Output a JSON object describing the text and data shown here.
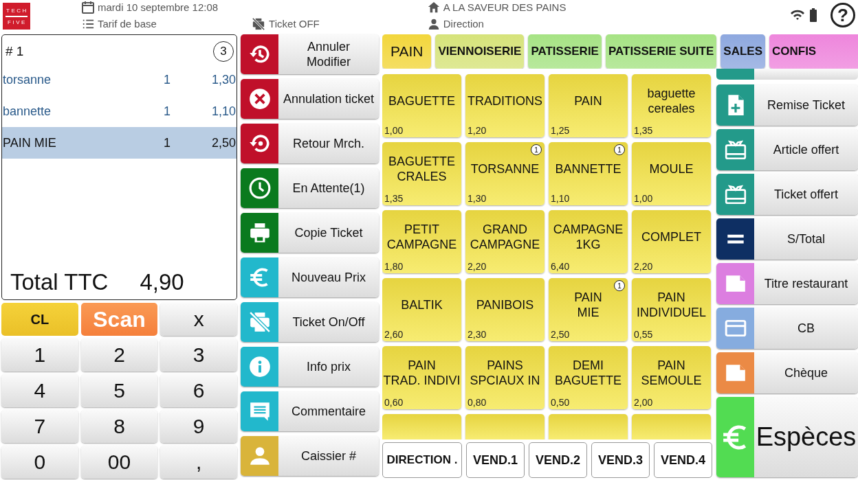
{
  "header": {
    "logo": {
      "top": "TECH",
      "bottom": "FIVE"
    },
    "date": "mardi 10 septembre 12:08",
    "tariff": "Tarif de base",
    "ticket_status": "Ticket OFF",
    "shop": "A LA SAVEUR DES PAINS",
    "user": "Direction",
    "help": "?"
  },
  "ticket": {
    "number": "# 1",
    "count": "3",
    "lines": [
      {
        "name": "torsanne",
        "qty": "1",
        "price": "1,30",
        "selected": false
      },
      {
        "name": "bannette",
        "qty": "1",
        "price": "1,10",
        "selected": false
      },
      {
        "name": "PAIN MIE",
        "qty": "1",
        "price": "2,50",
        "selected": true
      }
    ],
    "total_label": "Total TTC",
    "total": "4,90"
  },
  "keypad": [
    {
      "label": "CL",
      "kind": "clear"
    },
    {
      "label": "Scan",
      "kind": "scan"
    },
    {
      "label": "x",
      "kind": "key"
    },
    {
      "label": "1",
      "kind": "key"
    },
    {
      "label": "2",
      "kind": "key"
    },
    {
      "label": "3",
      "kind": "key"
    },
    {
      "label": "4",
      "kind": "key"
    },
    {
      "label": "5",
      "kind": "key"
    },
    {
      "label": "6",
      "kind": "key"
    },
    {
      "label": "7",
      "kind": "key"
    },
    {
      "label": "8",
      "kind": "key"
    },
    {
      "label": "9",
      "kind": "key"
    },
    {
      "label": "0",
      "kind": "key"
    },
    {
      "label": "00",
      "kind": "key"
    },
    {
      "label": ",",
      "kind": "key"
    }
  ],
  "actions": [
    {
      "label": "Annuler\nModifier",
      "kind": "history",
      "color": "#c0102a"
    },
    {
      "label": "Annulation ticket",
      "kind": "cancel",
      "color": "#c0102a"
    },
    {
      "label": "Retour Mrch.",
      "kind": "restore",
      "color": "#c0102a"
    },
    {
      "label": "En Attente(1)",
      "kind": "clock",
      "color": "#0a7a1e"
    },
    {
      "label": "Copie Ticket",
      "kind": "printer",
      "color": "#0a7a1e"
    },
    {
      "label": "Nouveau Prix",
      "kind": "euro",
      "color": "#22b8cc"
    },
    {
      "label": "Ticket On/Off",
      "kind": "printer-off",
      "color": "#22b8cc"
    },
    {
      "label": "Info prix",
      "kind": "info",
      "color": "#22b8cc"
    },
    {
      "label": "Commentaire",
      "kind": "comment",
      "color": "#22b8cc"
    },
    {
      "label": "Caissier #",
      "kind": "person",
      "color": "#d9b43a"
    }
  ],
  "categories": [
    {
      "label": "PAIN",
      "color": "#f2d63c",
      "selected": true
    },
    {
      "label": "VIENNOISERIE",
      "color": "#d6e37a",
      "selected": false
    },
    {
      "label": "PATISSERIE",
      "color": "#a6e384",
      "selected": false
    },
    {
      "label": "PATISSERIE SUITE",
      "color": "#a6e384",
      "selected": false
    },
    {
      "label": "SALES",
      "color": "#8ea8df",
      "selected": false
    },
    {
      "label": "CONFIS",
      "color": "#ee86dc",
      "selected": false
    }
  ],
  "products": [
    {
      "name": "BAGUETTE",
      "price": "1,00"
    },
    {
      "name": "TRADITIONS",
      "price": "1,20"
    },
    {
      "name": "PAIN",
      "price": "1,25"
    },
    {
      "name": "baguette\ncereales",
      "price": "1,35"
    },
    {
      "name": "BAGUETTE\nCRALES",
      "price": "1,35"
    },
    {
      "name": "TORSANNE",
      "price": "1,30",
      "badge": "1"
    },
    {
      "name": "BANNETTE",
      "price": "1,10",
      "badge": "1"
    },
    {
      "name": "MOULE",
      "price": "1,00"
    },
    {
      "name": "PETIT\nCAMPAGNE",
      "price": "1,80"
    },
    {
      "name": "GRAND\nCAMPAGNE",
      "price": "2,20"
    },
    {
      "name": "CAMPAGNE\n1KG",
      "price": "6,40"
    },
    {
      "name": "COMPLET",
      "price": "2,20"
    },
    {
      "name": "BALTIK",
      "price": "2,60"
    },
    {
      "name": "PANIBOIS",
      "price": "2,30"
    },
    {
      "name": "PAIN\nMIE",
      "price": "2,50",
      "badge": "1"
    },
    {
      "name": "PAIN\nINDIVIDUEL",
      "price": "0,55"
    },
    {
      "name": "PAIN\nTRAD. INDIVI",
      "price": "0,60"
    },
    {
      "name": "PAINS\nSPCIAUX IN",
      "price": "0,80"
    },
    {
      "name": "DEMI\nBAGUETTE",
      "price": "0,50"
    },
    {
      "name": "PAIN\nSEMOULE",
      "price": "2,00"
    }
  ],
  "sellers": [
    "DIRECTION .",
    "VEND.1",
    "VEND.2",
    "VEND.3",
    "VEND.4"
  ],
  "payments": [
    {
      "label": "Remise Ticket",
      "kind": "doc-plus",
      "color": "#239a8a"
    },
    {
      "label": "Article offert",
      "kind": "gift",
      "color": "#239a8a"
    },
    {
      "label": "Ticket offert",
      "kind": "gift",
      "color": "#239a8a"
    },
    {
      "label": "S/Total",
      "kind": "equals",
      "color": "#0e2f63"
    },
    {
      "label": "Titre restaurant",
      "kind": "doc",
      "color": "#dc7ee0"
    },
    {
      "label": "CB",
      "kind": "card",
      "color": "#86acdf"
    },
    {
      "label": "Chèque",
      "kind": "doc",
      "color": "#eb8a45"
    },
    {
      "label": "Espèces",
      "kind": "euro",
      "color": "#52dc52",
      "large": true
    }
  ]
}
